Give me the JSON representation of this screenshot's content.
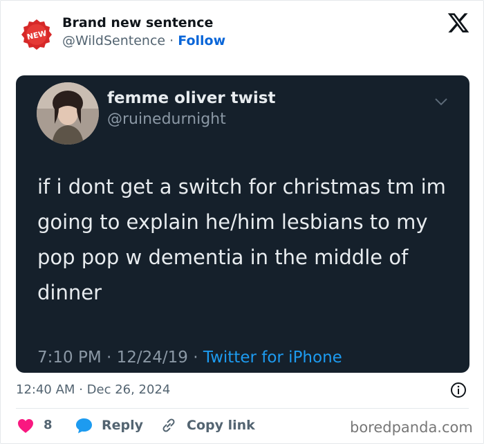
{
  "author": {
    "name": "Brand new sentence",
    "handle": "@WildSentence",
    "separator": "·",
    "follow_label": "Follow",
    "badge_text": "NEW",
    "badge_color": "#d62828"
  },
  "platform_icon": "x-logo-icon",
  "embedded_tweet": {
    "name": "femme oliver twist",
    "handle": "@ruinedurnight",
    "text": "if i dont get a switch for christmas tm im going to explain he/him lesbians to my pop pop w dementia in the middle of dinner",
    "time": "7:10 PM · 12/24/19 · ",
    "source": "Twitter for iPhone",
    "background_color": "#15202b"
  },
  "timestamp": {
    "time": "12:40 AM",
    "separator": "·",
    "date": "Dec 26, 2024"
  },
  "actions": {
    "like_count": "8",
    "reply_label": "Reply",
    "copy_link_label": "Copy link"
  },
  "watermark": "boredpanda.com",
  "colors": {
    "heart": "#f91880",
    "reply": "#1d9bf0",
    "follow": "#0a66d8"
  }
}
